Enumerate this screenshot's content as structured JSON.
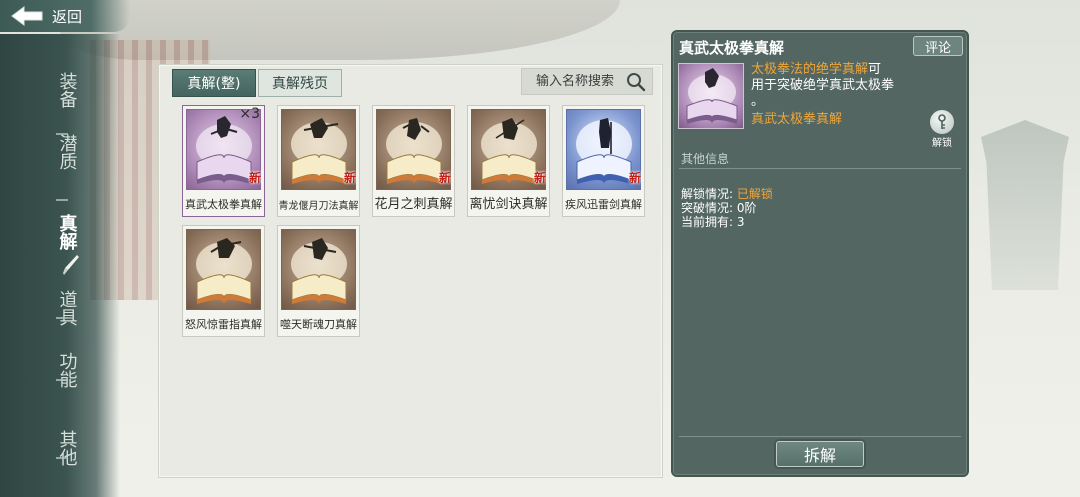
{
  "header": {
    "back_label": "返回"
  },
  "nav": {
    "items": [
      {
        "label": "装备",
        "active": false
      },
      {
        "label": "潜质",
        "active": false
      },
      {
        "label": "真解",
        "active": true
      },
      {
        "label": "道具",
        "active": false
      },
      {
        "label": "功能",
        "active": false
      },
      {
        "label": "其他",
        "active": false
      }
    ]
  },
  "tabs": [
    {
      "label": "真解(整)",
      "active": true
    },
    {
      "label": "真解残页",
      "active": false
    }
  ],
  "search": {
    "placeholder": "输入名称搜索",
    "value": "",
    "icon": "search-icon"
  },
  "items": [
    {
      "name": "真武太极拳真解",
      "new": "新",
      "count": "×3",
      "rarity": "purple",
      "selected": true
    },
    {
      "name": "青龙偃月刀法真解",
      "new": "新",
      "count": "",
      "rarity": "brown",
      "selected": false
    },
    {
      "name": "花月之刺真解",
      "new": "新",
      "count": "",
      "rarity": "brown",
      "selected": false
    },
    {
      "name": "离忧剑诀真解",
      "new": "新",
      "count": "",
      "rarity": "brown",
      "selected": false
    },
    {
      "name": "疾风迅雷剑真解",
      "new": "新",
      "count": "",
      "rarity": "blue",
      "selected": false
    },
    {
      "name": "怒风惊雷指真解",
      "new": "",
      "count": "",
      "rarity": "brown",
      "selected": false
    },
    {
      "name": "噬天断魂刀真解",
      "new": "",
      "count": "",
      "rarity": "brown",
      "selected": false
    }
  ],
  "detail": {
    "title": "真武太极拳真解",
    "comment_label": "评论",
    "desc_highlight": "太极拳法的绝学真解",
    "desc_rest_1": "可",
    "desc_rest_2": "用于突破绝学真武太极拳",
    "desc_rest_3": "。",
    "sub_name": "真武太极拳真解",
    "unlock_label": "解锁",
    "section_label": "其他信息",
    "info": [
      {
        "label": "解锁情况:",
        "value": "已解锁",
        "highlight": true
      },
      {
        "label": "突破情况:",
        "value": "0阶",
        "highlight": false
      },
      {
        "label": "当前拥有:",
        "value": "3",
        "highlight": false
      }
    ],
    "dismantle_label": "拆解"
  },
  "colors": {
    "accent": "#446560",
    "highlight": "#f0a73a",
    "new_badge": "#c0221a",
    "detail_bg": "#536661"
  }
}
